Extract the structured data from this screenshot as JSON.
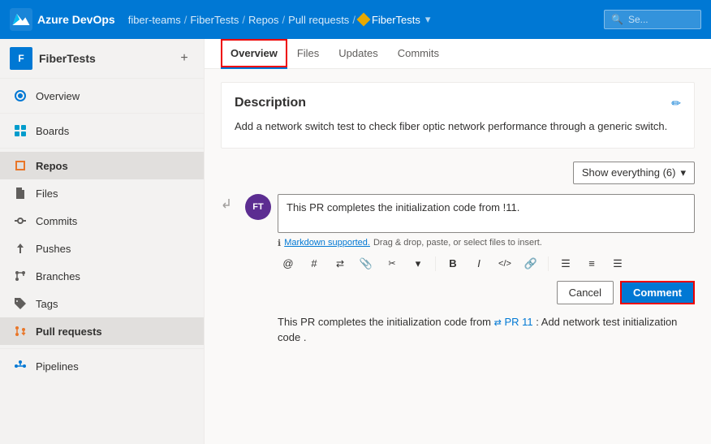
{
  "app": {
    "name": "Azure DevOps",
    "logo_text": "Azure DevOps"
  },
  "breadcrumb": {
    "items": [
      "fiber-teams",
      "FiberTests",
      "Repos",
      "Pull requests"
    ],
    "current": "FiberTests",
    "separators": [
      "/",
      "/",
      "/",
      "/"
    ]
  },
  "search": {
    "placeholder": "Se..."
  },
  "sidebar": {
    "project_name": "FiberTests",
    "project_initial": "F",
    "add_label": "+",
    "nav_items": [
      {
        "id": "overview",
        "label": "Overview",
        "icon": "overview"
      },
      {
        "id": "boards",
        "label": "Boards",
        "icon": "boards"
      },
      {
        "id": "repos",
        "label": "Repos",
        "icon": "repos"
      },
      {
        "id": "files",
        "label": "Files",
        "icon": "files"
      },
      {
        "id": "commits",
        "label": "Commits",
        "icon": "commits"
      },
      {
        "id": "pushes",
        "label": "Pushes",
        "icon": "pushes"
      },
      {
        "id": "branches",
        "label": "Branches",
        "icon": "branches"
      },
      {
        "id": "tags",
        "label": "Tags",
        "icon": "tags"
      },
      {
        "id": "pull-requests",
        "label": "Pull requests",
        "icon": "pullreqs"
      },
      {
        "id": "pipelines",
        "label": "Pipelines",
        "icon": "pipelines"
      }
    ]
  },
  "tabs": [
    {
      "id": "overview",
      "label": "Overview",
      "active": true
    },
    {
      "id": "files",
      "label": "Files",
      "active": false
    },
    {
      "id": "updates",
      "label": "Updates",
      "active": false
    },
    {
      "id": "commits",
      "label": "Commits",
      "active": false
    }
  ],
  "description": {
    "title": "Description",
    "body": "Add a network switch test to check fiber optic network performance through a generic switch.",
    "edit_icon": "✏"
  },
  "show_everything": {
    "label": "Show everything (6)",
    "chevron": "▾"
  },
  "comment": {
    "avatar_initials": "FT",
    "avatar_bg": "#5c2d91",
    "text": "This PR completes the initialization code from !11.",
    "markdown_hint": "Markdown supported.",
    "markdown_hint_suffix": " Drag & drop, paste, or select files to insert.",
    "toolbar_items": [
      "@",
      "#",
      "⇄",
      "📎",
      "✂",
      "▾",
      "B",
      "I",
      "</>",
      "🔗",
      "≡",
      "≡",
      "≡"
    ],
    "cancel_label": "Cancel",
    "comment_label": "Comment"
  },
  "pr_link": {
    "text_before": "This PR completes the initialization code from ",
    "link1_icon": "⇄",
    "link1_label": "PR 11",
    "text_middle": ": Add network test initialization code",
    "text_after": " ."
  }
}
